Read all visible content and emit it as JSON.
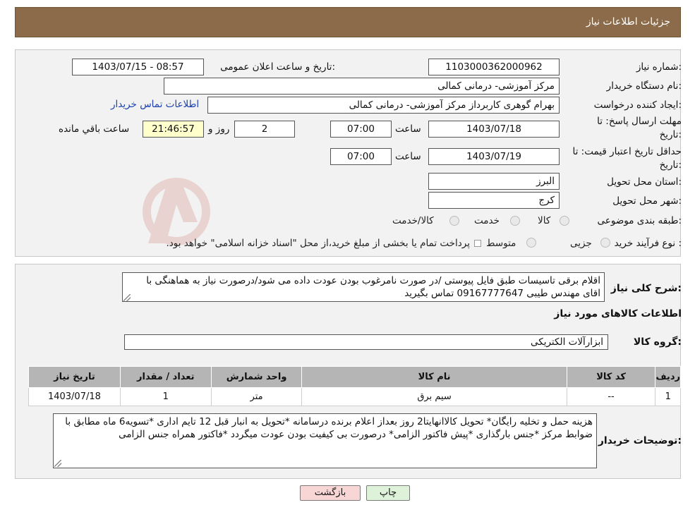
{
  "header": {
    "title": "جزئیات اطلاعات نیاز"
  },
  "form": {
    "need_number_label": "شماره نیاز:",
    "need_number": "1103000362000962",
    "announce_datetime_label": "تاریخ و ساعت اعلان عمومی:",
    "announce_datetime": "1403/07/15 - 08:57",
    "buyer_org_label": "نام دستگاه خریدار:",
    "buyer_org": "مرکز آموزشی- درمانی کمالی",
    "requester_label": "ایجاد کننده درخواست:",
    "requester": "بهرام گوهری کاربرداز مرکز آموزشی- درمانی کمالی",
    "contact_link": "اطلاعات تماس خریدار",
    "reply_deadline_label_1": "مهلت ارسال پاسخ: تا",
    "reply_deadline_label_2": "تاریخ:",
    "reply_date": "1403/07/18",
    "hour_label": "ساعت",
    "reply_time": "07:00",
    "days_value": "2",
    "days_label": "روز و",
    "remaining_time": "21:46:57",
    "remaining_label": "ساعت باقي مانده",
    "price_validity_label_1": "حداقل تاریخ اعتبار قیمت: تا",
    "price_validity_label_2": "تاریخ:",
    "validity_date": "1403/07/19",
    "validity_hour_label": "ساعت",
    "validity_time": "07:00",
    "province_label": "استان محل تحویل:",
    "province": "البرز",
    "city_label": "شهر محل تحویل:",
    "city": "کرج",
    "category_label": "طبقه بندی موضوعی:",
    "category_options": [
      "کالا",
      "خدمت",
      "کالا/خدمت"
    ],
    "process_label": "نوع فرآیند خرید :",
    "process_options": [
      "جزیی",
      "متوسط"
    ],
    "process_note": "پرداخت تمام یا بخشی از مبلغ خرید،از محل \"اسناد خزانه اسلامی\" خواهد بود."
  },
  "details": {
    "summary_label": "شرح کلی نیاز:",
    "summary_text": "اقلام برقی تاسیسات طبق فایل پیوستی /در صورت نامرغوب بودن عودت داده می شود/درصورت نیاز به هماهنگی با اقای مهندس طیبی 09167777647 تماس بگیرید",
    "goods_info_title": "اطلاعات کالاهای مورد نیاز",
    "goods_group_label": "گروه کالا:",
    "goods_group": "ابزارآلات الکتریکی",
    "table": {
      "headers": [
        "ردیف",
        "کد کالا",
        "نام کالا",
        "واحد شمارش",
        "تعداد / مقدار",
        "تاریخ نیاز"
      ],
      "rows": [
        [
          "1",
          "--",
          "سیم برق",
          "متر",
          "1",
          "1403/07/18"
        ]
      ]
    },
    "buyer_notes_label": "توضیحات خریدار:",
    "buyer_notes_text": "هزینه حمل و تخلیه رایگان* تحویل کالاانهایتا2 روز بعداز اعلام برنده درسامانه *تحویل به انبار قبل 12 تایم اداری *تسویه6 ماه مطابق با ضوابط مرکز *جنس بارگذاری *پیش فاکتور الزامی* درصورت بی کیفیت بودن عودت میگردد *فاکتور همراه جنس الزامی"
  },
  "buttons": {
    "back": "بازگشت",
    "print": "چاپ"
  }
}
